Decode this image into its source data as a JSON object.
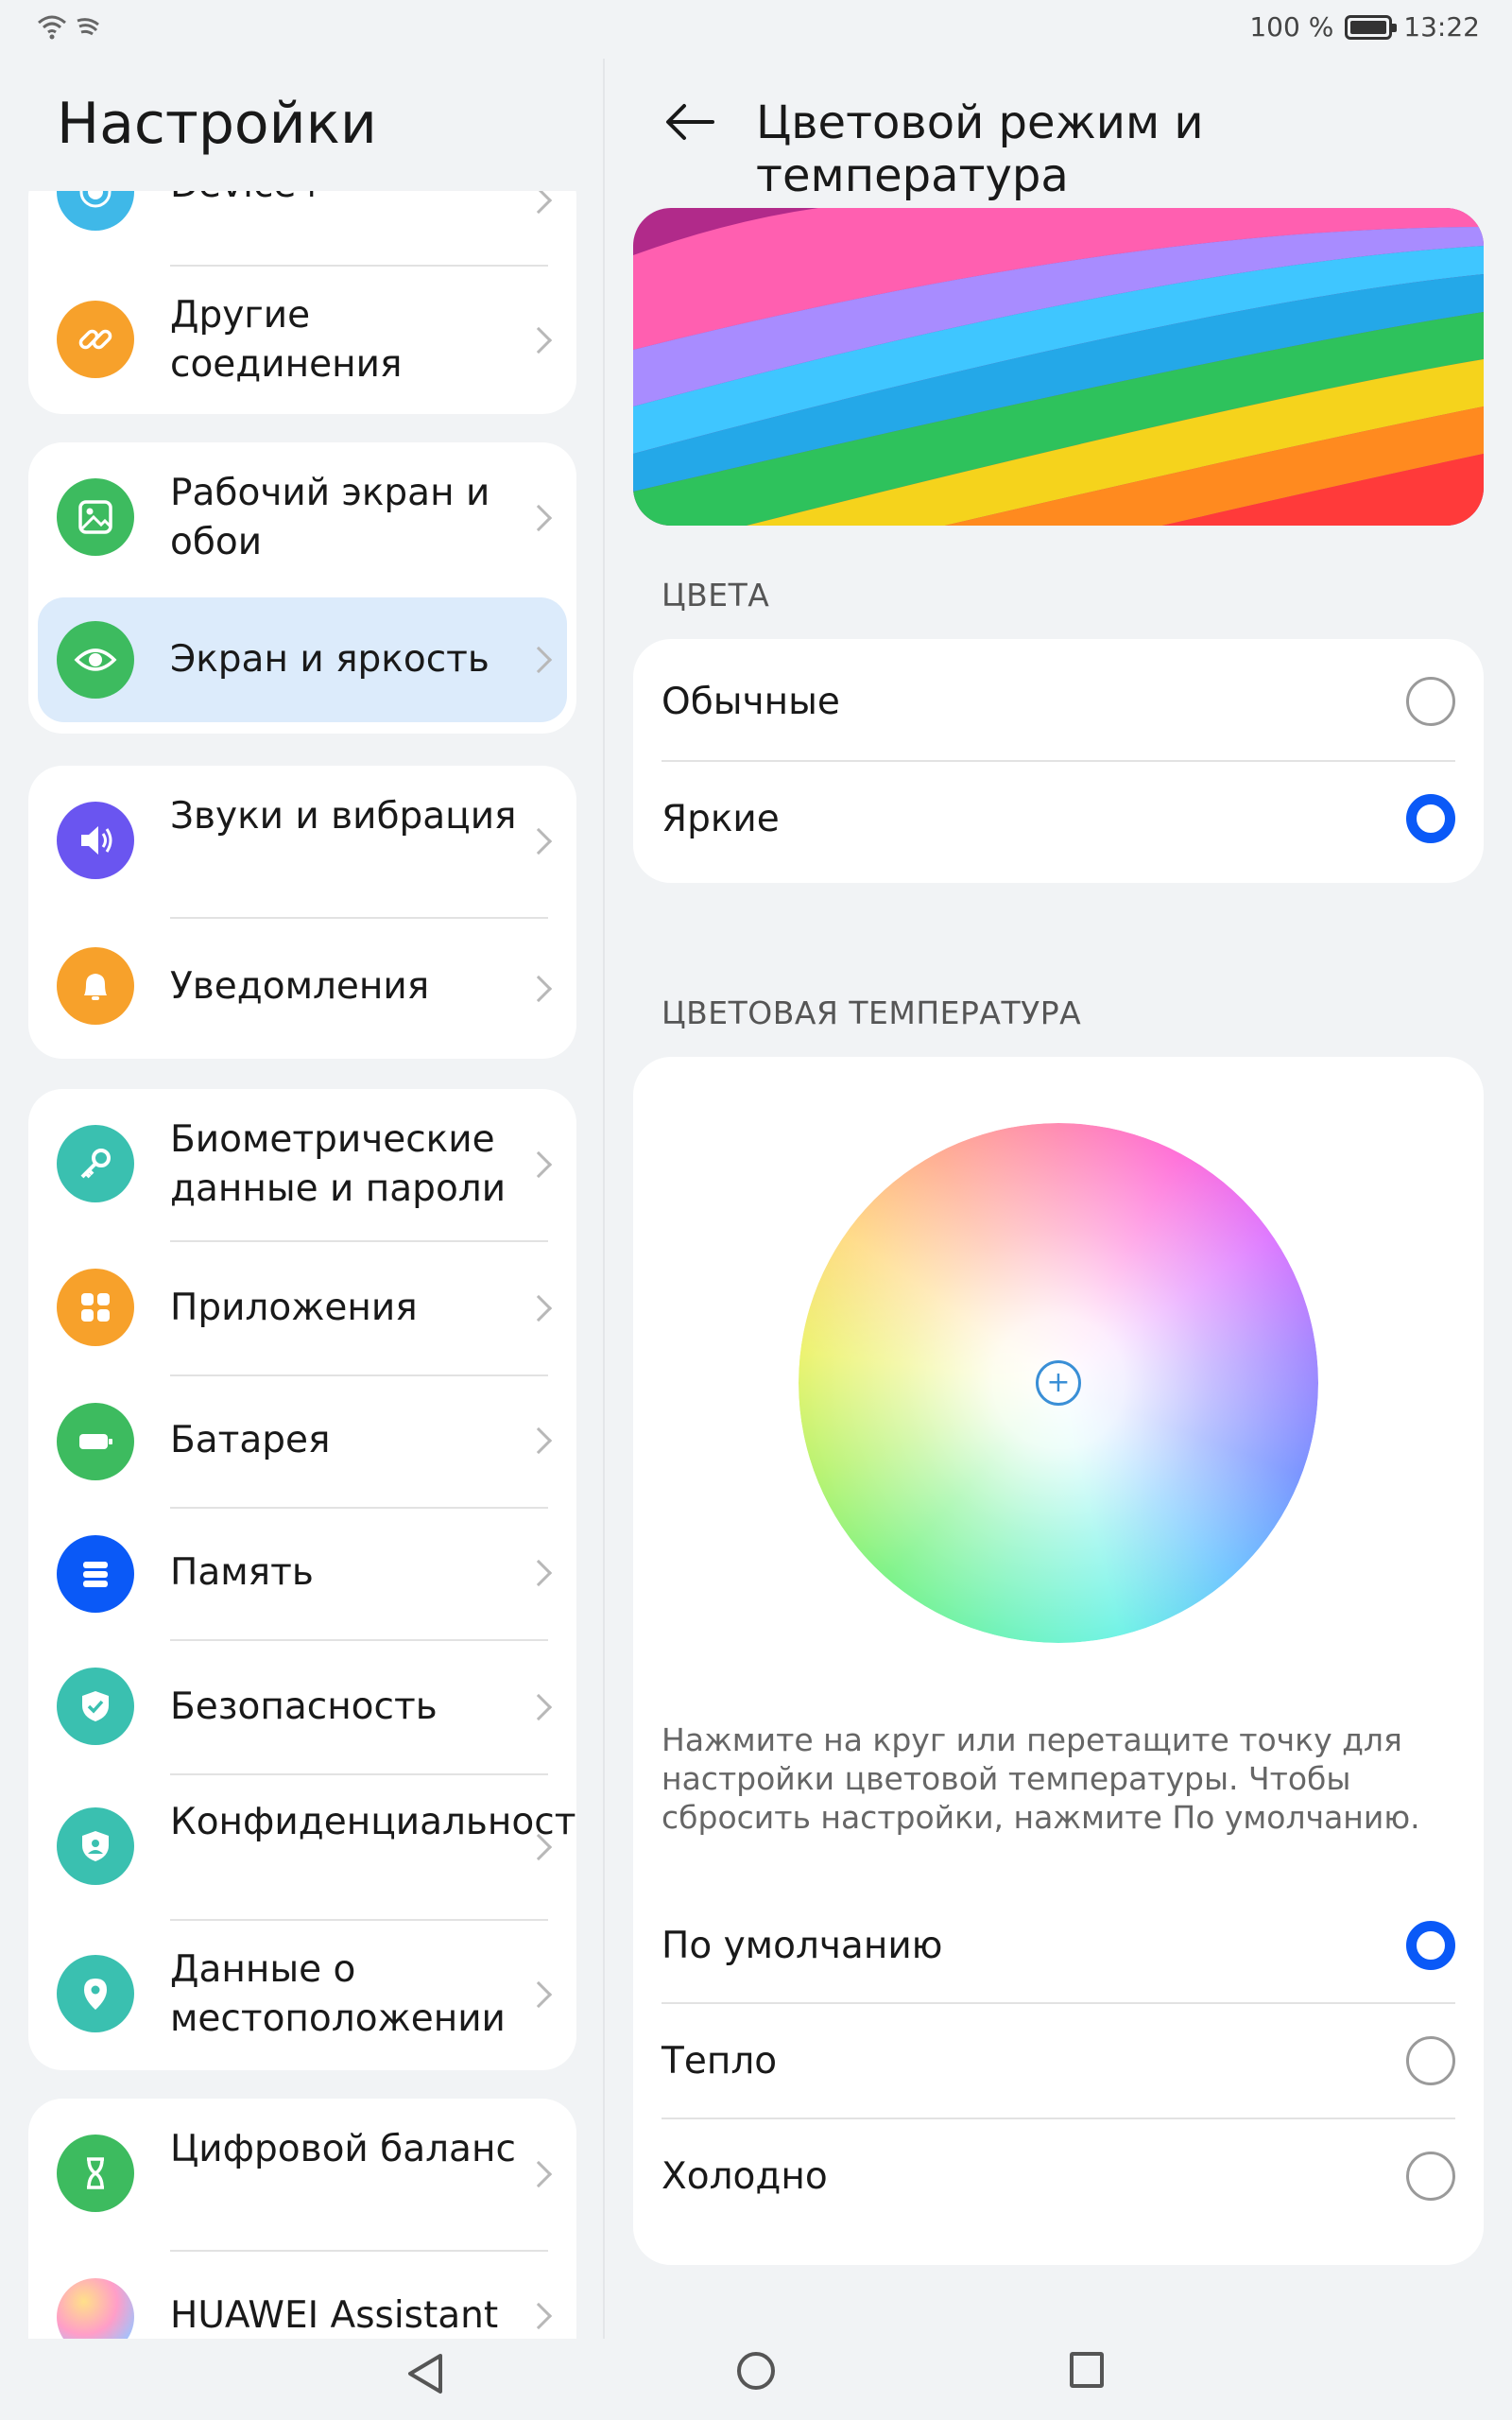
{
  "status_bar": {
    "battery": "100 %",
    "battery_level": 1.0,
    "time": "13:22"
  },
  "left_pane": {
    "title": "Настройки",
    "items": [
      {
        "label": "Device+",
        "icon": "device-plus-icon",
        "color": "#3fb8e8"
      },
      {
        "label": "Другие соединения",
        "icon": "link-icon",
        "color": "#f7a12b"
      },
      {
        "label": "Рабочий экран и обои",
        "icon": "wallpaper-icon",
        "color": "#3dbb5f"
      },
      {
        "label": "Экран и яркость",
        "icon": "eye-icon",
        "color": "#3dbb5f",
        "active": true
      },
      {
        "label": "Звуки и вибрация",
        "icon": "speaker-icon",
        "color": "#6a55f0"
      },
      {
        "label": "Уведомления",
        "icon": "bell-icon",
        "color": "#f7a12b"
      },
      {
        "label": "Биометрические данные и пароли",
        "icon": "key-icon",
        "color": "#3ac0b0"
      },
      {
        "label": "Приложения",
        "icon": "apps-icon",
        "color": "#f7a12b"
      },
      {
        "label": "Батарея",
        "icon": "battery-icon",
        "color": "#3dbb5f"
      },
      {
        "label": "Память",
        "icon": "storage-icon",
        "color": "#0a59f7"
      },
      {
        "label": "Безопасность",
        "icon": "shield-check-icon",
        "color": "#3ac0b0"
      },
      {
        "label": "Конфиденциальность",
        "icon": "privacy-icon",
        "color": "#3ac0b0"
      },
      {
        "label": "Данные о местоположении",
        "icon": "location-icon",
        "color": "#3ac0b0"
      },
      {
        "label": "Цифровой баланс",
        "icon": "hourglass-icon",
        "color": "#3dbb5f"
      },
      {
        "label": "HUAWEI Assistant",
        "icon": "huawei-assistant-icon",
        "color": "#f0a0c8"
      }
    ]
  },
  "right_pane": {
    "title": "Цветовой режим и температура",
    "colors_section": {
      "label": "ЦВЕТА",
      "options": [
        {
          "label": "Обычные",
          "selected": false
        },
        {
          "label": "Яркие",
          "selected": true
        }
      ]
    },
    "temperature_section": {
      "label": "ЦВЕТОВАЯ ТЕМПЕРАТУРА",
      "hint": "Нажмите на круг или перетащите точку для настройки цветовой температуры. Чтобы сбросить настройки, нажмите По умолчанию.",
      "options": [
        {
          "label": "По умолчанию",
          "selected": true
        },
        {
          "label": "Тепло",
          "selected": false
        },
        {
          "label": "Холодно",
          "selected": false
        }
      ]
    }
  },
  "colors": {
    "accent": "#0a59f7",
    "active_item_bg": "#dcebfb"
  }
}
